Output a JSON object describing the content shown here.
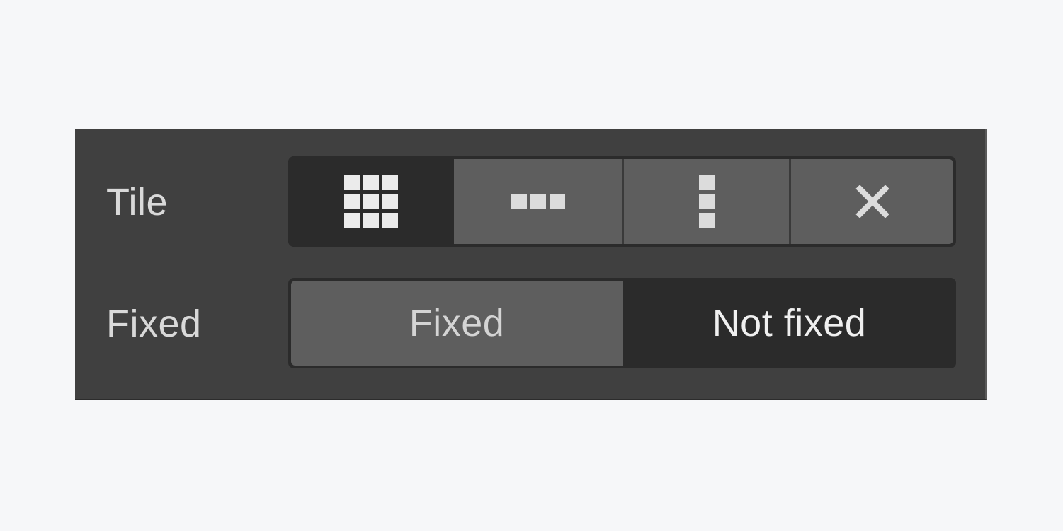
{
  "tile": {
    "label": "Tile",
    "options": [
      {
        "name": "repeat",
        "icon": "grid-icon",
        "selected": true
      },
      {
        "name": "repeat-x",
        "icon": "horizontal-dots-icon",
        "selected": false
      },
      {
        "name": "repeat-y",
        "icon": "vertical-dots-icon",
        "selected": false
      },
      {
        "name": "no-repeat",
        "icon": "close-icon",
        "selected": false
      }
    ]
  },
  "fixed": {
    "label": "Fixed",
    "options": [
      {
        "label": "Fixed",
        "selected": false
      },
      {
        "label": "Not fixed",
        "selected": true
      }
    ]
  },
  "colors": {
    "page_bg": "#f6f7f9",
    "panel_bg": "#404040",
    "selected_bg": "#2b2b2b",
    "unselected_bg": "#5e5e5e",
    "icon_color": "#e6e6e6"
  }
}
